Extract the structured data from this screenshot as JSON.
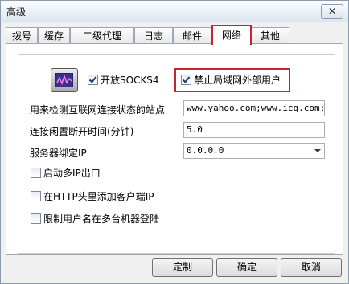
{
  "window": {
    "title": "高级",
    "close_glyph": "✕"
  },
  "tabs": [
    {
      "label": "拨号"
    },
    {
      "label": "缓存"
    },
    {
      "label": "二级代理"
    },
    {
      "label": "日志"
    },
    {
      "label": "邮件"
    },
    {
      "label": "网络",
      "active": true
    },
    {
      "label": "其他"
    }
  ],
  "network": {
    "enable_socks4": {
      "label": "开放SOCKS4",
      "checked": true
    },
    "block_lan_users": {
      "label": "禁止局域网外部用户",
      "checked": true
    },
    "check_sites": {
      "label": "用来检测互联网连接状态的站点",
      "value": "www.yahoo.com;www.icq.com;ww"
    },
    "idle_timeout": {
      "label": "连接闲置断开时间(分钟)",
      "value": "5.0"
    },
    "bind_ip": {
      "label": "服务器绑定IP",
      "value": "0.0.0.0"
    },
    "multi_ip_exit": {
      "label": "启动多IP出口",
      "checked": false
    },
    "add_client_ip_header": {
      "label": "在HTTP头里添加客户端IP",
      "checked": false
    },
    "limit_username_machines": {
      "label": "限制用户名在多台机器登陆",
      "checked": false
    }
  },
  "buttons": {
    "customize": "定制",
    "ok": "确定",
    "cancel": "取消"
  },
  "colors": {
    "highlight": "#c0262c"
  }
}
